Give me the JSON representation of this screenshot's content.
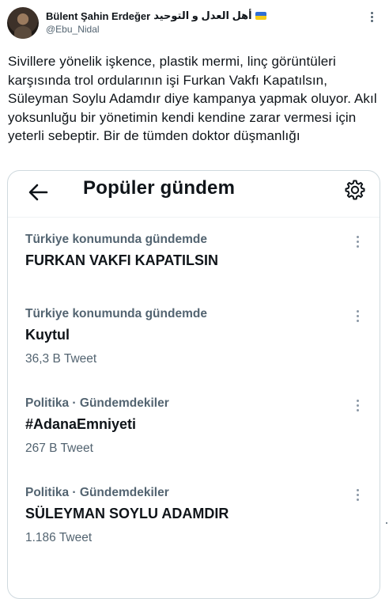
{
  "author": {
    "name": "Bülent Şahin Erdeğer",
    "name_arabic": "أهل العدل و التوحيد",
    "handle": "@Ebu_Nidal",
    "flag_colors": [
      "#2f6fd6",
      "#f5cc18"
    ]
  },
  "tweet": {
    "text": "Sivillere yönelik işkence, plastik mermi, linç görüntüleri karşısında trol ordularının işi Furkan Vakfı Kapatılsın, Süleyman Soylu Adamdır diye kampanya yapmak oluyor. Akıl yoksunluğu bir yönetimin kendi kendine zarar vermesi için yeterli sebeptir. Bir de tümden doktor düşmanlığı"
  },
  "card": {
    "title": "Popüler gündem",
    "icons": {
      "back": "back-arrow-icon",
      "settings": "gear-icon"
    },
    "trends": [
      {
        "context": "Türkiye konumunda gündemde",
        "name": "FURKAN VAKFI KAPATILSIN",
        "count": ""
      },
      {
        "context": "Türkiye konumunda gündemde",
        "name": "Kuytul",
        "count": "36,3 B Tweet"
      },
      {
        "context": "Politika · Gündemdekiler",
        "name": "#AdanaEmniyeti",
        "count": "267 B Tweet"
      },
      {
        "context": "Politika · Gündemdekiler",
        "name": "SÜLEYMAN SOYLU ADAMDIR",
        "count": "1.186 Tweet"
      }
    ]
  }
}
